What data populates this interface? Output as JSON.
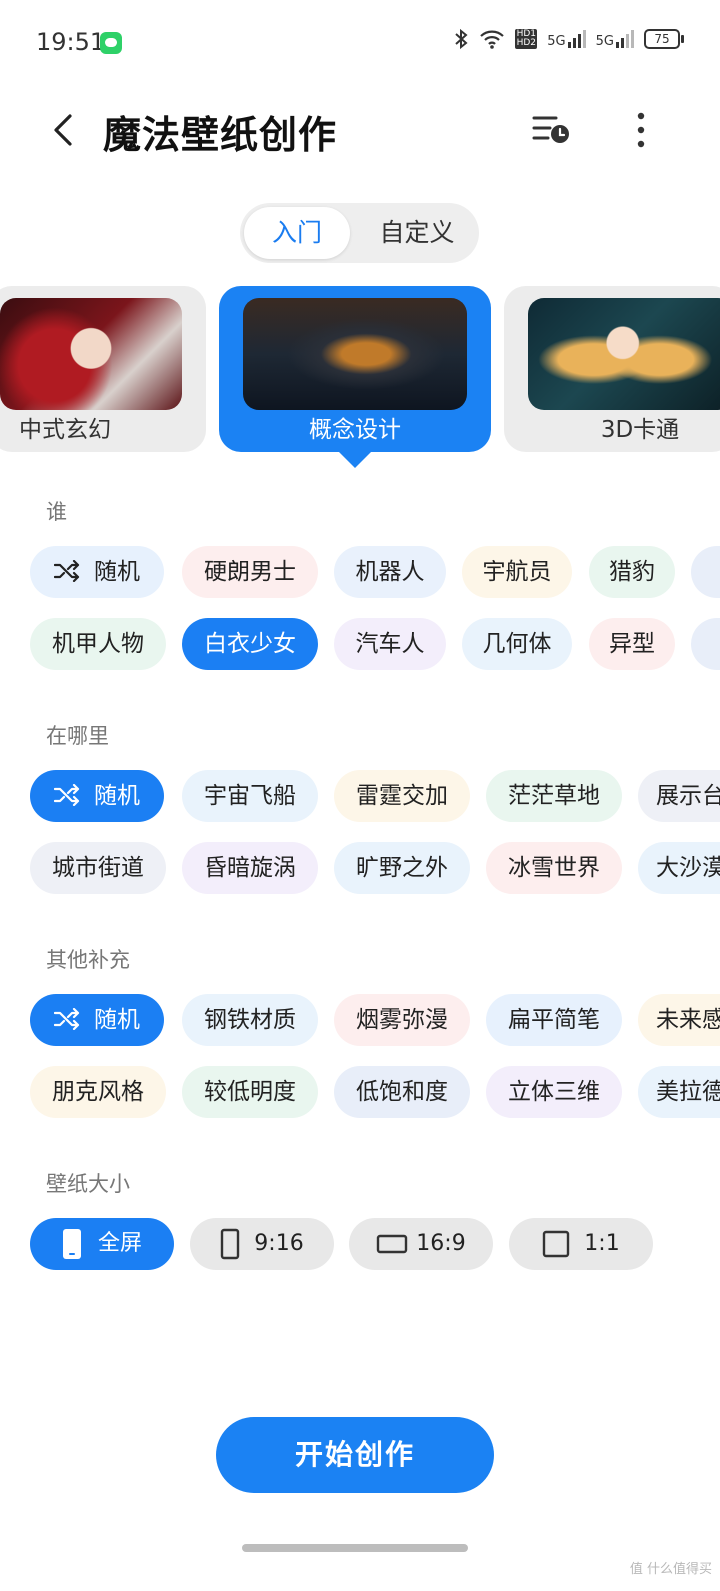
{
  "status_bar": {
    "time": "19:51",
    "hd_label": "HD1 HD2",
    "signal1": "5G",
    "signal2": "5G",
    "battery": "75",
    "icons": [
      "message-app-icon",
      "bluetooth-icon",
      "wifi-icon",
      "hd-icon",
      "signal-icon",
      "signal-icon",
      "battery-icon"
    ]
  },
  "header": {
    "title": "魔法壁纸创作",
    "icons": [
      "back-icon",
      "history-icon",
      "more-icon"
    ]
  },
  "mode_tabs": [
    {
      "label": "入门",
      "active": true
    },
    {
      "label": "自定义",
      "active": false
    }
  ],
  "styles": [
    {
      "label": "中式玄幻",
      "selected": false
    },
    {
      "label": "概念设计",
      "selected": true
    },
    {
      "label": "3D卡通",
      "selected": false
    }
  ],
  "sections": {
    "who": {
      "title": "谁",
      "row1": [
        "随机",
        "硬朗男士",
        "机器人",
        "宇航员",
        "猎豹"
      ],
      "row2": [
        "机甲人物",
        "白衣少女",
        "汽车人",
        "几何体",
        "异型"
      ],
      "selected": "白衣少女"
    },
    "where": {
      "title": "在哪里",
      "row1": [
        "随机",
        "宇宙飞船",
        "雷霆交加",
        "茫茫草地",
        "展示台"
      ],
      "row2": [
        "城市街道",
        "昏暗旋涡",
        "旷野之外",
        "冰雪世界",
        "大沙漠"
      ],
      "selected": "随机"
    },
    "extra": {
      "title": "其他补充",
      "row1": [
        "随机",
        "钢铁材质",
        "烟雾弥漫",
        "扁平简笔",
        "未来感"
      ],
      "row2": [
        "朋克风格",
        "较低明度",
        "低饱和度",
        "立体三维",
        "美拉德"
      ],
      "selected": "随机"
    },
    "size": {
      "title": "壁纸大小",
      "options": [
        "全屏",
        "9:16",
        "16:9",
        "1:1"
      ],
      "selected": "全屏"
    }
  },
  "start_button": "开始创作",
  "watermark": "值 什么值得买",
  "colors": {
    "accent": "#1b7ff3",
    "chip_tints": [
      "#e7f1fd",
      "#fdeeee",
      "#e9f1fc",
      "#fdf6e8",
      "#e9f6ef",
      "#eef0f6",
      "#f3eefb"
    ]
  }
}
